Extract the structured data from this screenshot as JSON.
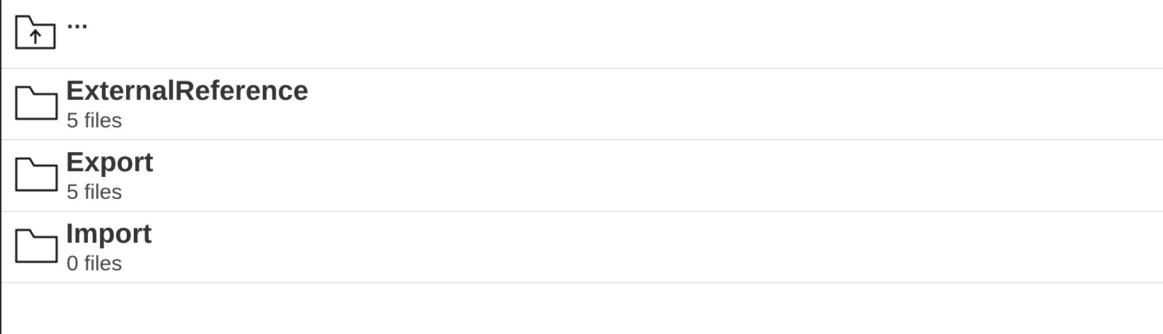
{
  "parent_row": {
    "icon": "folder-up-icon",
    "label": "..."
  },
  "folders": [
    {
      "icon": "folder-icon",
      "name": "ExternalReference",
      "count": "5 files"
    },
    {
      "icon": "folder-icon",
      "name": "Export",
      "count": "5 files"
    },
    {
      "icon": "folder-icon",
      "name": "Import",
      "count": "0 files"
    }
  ],
  "colors": {
    "text": "#333333",
    "divider": "#d6d6d6",
    "background": "#ffffff"
  }
}
